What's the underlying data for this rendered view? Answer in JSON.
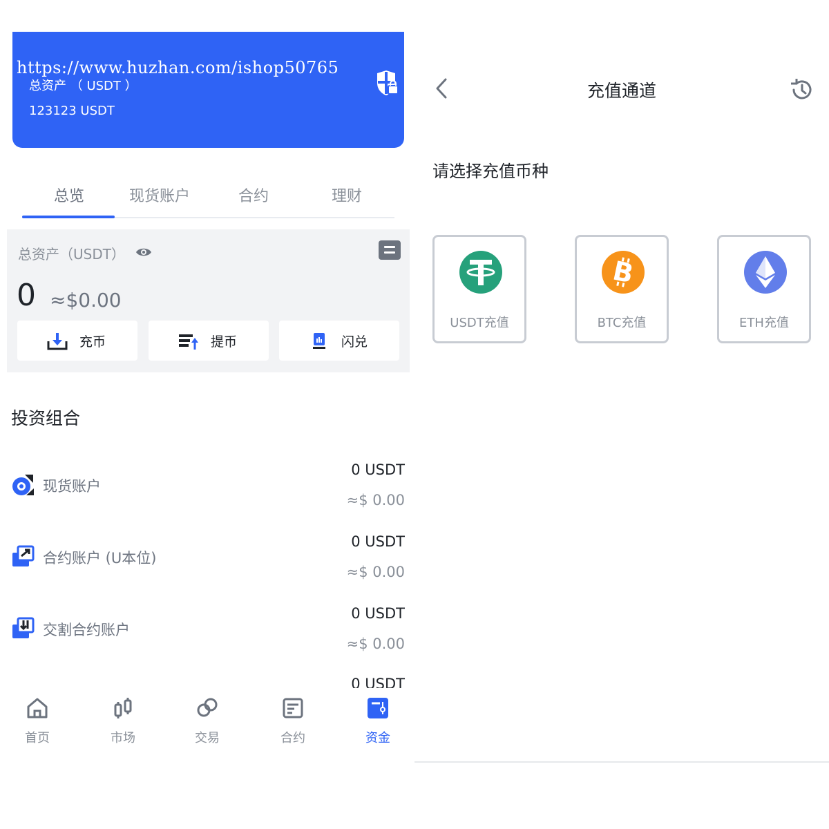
{
  "left": {
    "banner": {
      "watermark": "https://www.huzhan.com/ishop50765",
      "label": "总资产 （ USDT ）",
      "value": "123123 USDT"
    },
    "tabs": [
      {
        "label": "总览",
        "active": true
      },
      {
        "label": "现货账户",
        "active": false
      },
      {
        "label": "合约",
        "active": false
      },
      {
        "label": "理财",
        "active": false
      }
    ],
    "asset": {
      "title": "总资产（USDT）",
      "amount": "0",
      "usd": "≈$0.00"
    },
    "actions": [
      {
        "label": "充币",
        "icon": "deposit-icon"
      },
      {
        "label": "提币",
        "icon": "withdraw-icon"
      },
      {
        "label": "闪兑",
        "icon": "flash-exchange-icon"
      }
    ],
    "portfolio": {
      "title": "投资组合",
      "rows": [
        {
          "name": "现货账户",
          "value": "0 USDT",
          "usd": "≈$ 0.00",
          "icon": "spot-account-icon"
        },
        {
          "name": "合约账户 (U本位)",
          "value": "0 USDT",
          "usd": "≈$ 0.00",
          "icon": "contract-account-icon"
        },
        {
          "name": "交割合约账户",
          "value": "0 USDT",
          "usd": "≈$ 0.00",
          "icon": "delivery-contract-icon"
        },
        {
          "name": "",
          "value": "0 USDT",
          "usd": "",
          "icon": ""
        }
      ]
    },
    "nav": [
      {
        "label": "首页",
        "icon": "home-icon",
        "active": false
      },
      {
        "label": "市场",
        "icon": "market-icon",
        "active": false
      },
      {
        "label": "交易",
        "icon": "trade-icon",
        "active": false
      },
      {
        "label": "合约",
        "icon": "contract-icon",
        "active": false
      },
      {
        "label": "资金",
        "icon": "funds-icon",
        "active": true
      }
    ]
  },
  "right": {
    "title": "充值通道",
    "prompt": "请选择充值币种",
    "coins": [
      {
        "label": "USDT充值",
        "icon": "usdt-icon",
        "color": "#26a17b"
      },
      {
        "label": "BTC充值",
        "icon": "btc-icon",
        "color": "#f7931a"
      },
      {
        "label": "ETH充值",
        "icon": "eth-icon",
        "color": "#627eea"
      }
    ]
  },
  "colors": {
    "accent": "#2f63f5",
    "text": "#1f2329",
    "muted": "#8a9099"
  }
}
